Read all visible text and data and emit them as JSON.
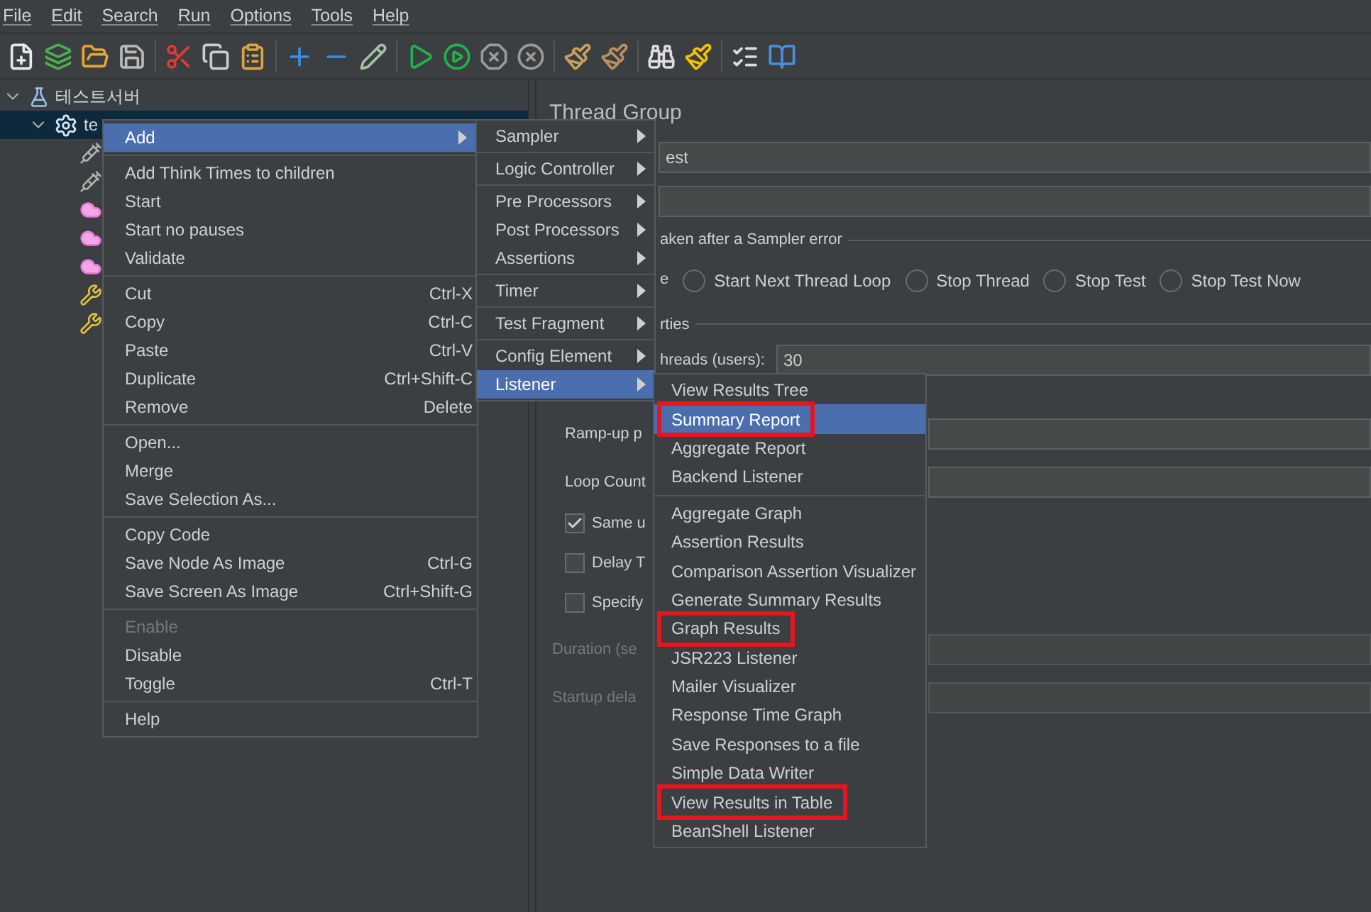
{
  "menu_bar": [
    "File",
    "Edit",
    "Search",
    "Run",
    "Options",
    "Tools",
    "Help"
  ],
  "tree": [
    {
      "label": "테스트서버",
      "kind": "plan",
      "expanded": true,
      "selected": false,
      "children": [
        {
          "label": "te",
          "kind": "group",
          "expanded": true,
          "selected": true,
          "children": [
            {
              "kind": "sampler"
            },
            {
              "kind": "sampler"
            },
            {
              "kind": "listener"
            },
            {
              "kind": "listener"
            },
            {
              "kind": "listener"
            },
            {
              "kind": "config"
            },
            {
              "kind": "config"
            }
          ]
        }
      ]
    }
  ],
  "panel": {
    "title": "Thread Group",
    "name_value": "est",
    "error_group": {
      "legend": "aken after a Sampler error",
      "continue_fragment": "e",
      "options": [
        {
          "label": "Start Next Thread Loop",
          "selected": false
        },
        {
          "label": "Stop Thread",
          "selected": false
        },
        {
          "label": "Stop Test",
          "selected": false
        },
        {
          "label": "Stop Test Now",
          "selected": false
        }
      ]
    },
    "properties": {
      "legend": "rties",
      "threads_label": "hreads (users):",
      "threads_value": "30",
      "rows": [
        {
          "label": "Ramp-up p",
          "disabled": false
        },
        {
          "label": "Loop Count",
          "disabled": false
        }
      ],
      "checks": [
        {
          "label": "Same u",
          "checked": true
        },
        {
          "label": "Delay T",
          "checked": false
        },
        {
          "label": "Specify",
          "checked": false
        }
      ],
      "late_rows": [
        {
          "label": "Duration (se",
          "disabled": true
        },
        {
          "label": "Startup dela",
          "disabled": true
        }
      ]
    }
  },
  "context_menu": [
    {
      "kind": "item",
      "label": "Add",
      "submenu": true,
      "selected": true,
      "disabled": false
    },
    {
      "kind": "separator"
    },
    {
      "kind": "item",
      "label": "Add Think Times to children",
      "selected": false,
      "disabled": false
    },
    {
      "kind": "item",
      "label": "Start",
      "selected": false,
      "disabled": false
    },
    {
      "kind": "item",
      "label": "Start no pauses",
      "selected": false,
      "disabled": false
    },
    {
      "kind": "item",
      "label": "Validate",
      "selected": false,
      "disabled": false
    },
    {
      "kind": "separator"
    },
    {
      "kind": "item",
      "label": "Cut",
      "shortcut": "Ctrl-X",
      "selected": false,
      "disabled": false
    },
    {
      "kind": "item",
      "label": "Copy",
      "shortcut": "Ctrl-C",
      "selected": false,
      "disabled": false
    },
    {
      "kind": "item",
      "label": "Paste",
      "shortcut": "Ctrl-V",
      "selected": false,
      "disabled": false
    },
    {
      "kind": "item",
      "label": "Duplicate",
      "shortcut": "Ctrl+Shift-C",
      "selected": false,
      "disabled": false
    },
    {
      "kind": "item",
      "label": "Remove",
      "shortcut": "Delete",
      "selected": false,
      "disabled": false
    },
    {
      "kind": "separator"
    },
    {
      "kind": "item",
      "label": "Open...",
      "selected": false,
      "disabled": false
    },
    {
      "kind": "item",
      "label": "Merge",
      "selected": false,
      "disabled": false
    },
    {
      "kind": "item",
      "label": "Save Selection As...",
      "selected": false,
      "disabled": false
    },
    {
      "kind": "separator"
    },
    {
      "kind": "item",
      "label": "Copy Code",
      "selected": false,
      "disabled": false
    },
    {
      "kind": "item",
      "label": "Save Node As Image",
      "shortcut": "Ctrl-G",
      "selected": false,
      "disabled": false
    },
    {
      "kind": "item",
      "label": "Save Screen As Image",
      "shortcut": "Ctrl+Shift-G",
      "selected": false,
      "disabled": false
    },
    {
      "kind": "separator"
    },
    {
      "kind": "item",
      "label": "Enable",
      "selected": false,
      "disabled": true
    },
    {
      "kind": "item",
      "label": "Disable",
      "selected": false,
      "disabled": false
    },
    {
      "kind": "item",
      "label": "Toggle",
      "shortcut": "Ctrl-T",
      "selected": false,
      "disabled": false
    },
    {
      "kind": "separator"
    },
    {
      "kind": "item",
      "label": "Help",
      "selected": false,
      "disabled": false
    }
  ],
  "add_submenu": [
    {
      "kind": "item",
      "label": "Sampler",
      "selected": false
    },
    {
      "kind": "separator"
    },
    {
      "kind": "item",
      "label": "Logic Controller",
      "selected": false
    },
    {
      "kind": "separator"
    },
    {
      "kind": "item",
      "label": "Pre Processors",
      "selected": false
    },
    {
      "kind": "item",
      "label": "Post Processors",
      "selected": false
    },
    {
      "kind": "item",
      "label": "Assertions",
      "selected": false
    },
    {
      "kind": "separator"
    },
    {
      "kind": "item",
      "label": "Timer",
      "selected": false
    },
    {
      "kind": "separator"
    },
    {
      "kind": "item",
      "label": "Test Fragment",
      "selected": false
    },
    {
      "kind": "separator"
    },
    {
      "kind": "item",
      "label": "Config Element",
      "selected": false
    },
    {
      "kind": "item",
      "label": "Listener",
      "selected": true
    }
  ],
  "listener_submenu": [
    {
      "kind": "item",
      "label": "View Results Tree",
      "selected": false,
      "marked": false
    },
    {
      "kind": "item",
      "label": "Summary Report",
      "selected": true,
      "marked": true
    },
    {
      "kind": "item",
      "label": "Aggregate Report",
      "selected": false,
      "marked": false
    },
    {
      "kind": "item",
      "label": "Backend Listener",
      "selected": false,
      "marked": false
    },
    {
      "kind": "separator"
    },
    {
      "kind": "item",
      "label": "Aggregate Graph",
      "selected": false,
      "marked": false
    },
    {
      "kind": "item",
      "label": "Assertion Results",
      "selected": false,
      "marked": false
    },
    {
      "kind": "item",
      "label": "Comparison Assertion Visualizer",
      "selected": false,
      "marked": false
    },
    {
      "kind": "item",
      "label": "Generate Summary Results",
      "selected": false,
      "marked": false
    },
    {
      "kind": "item",
      "label": "Graph Results",
      "selected": false,
      "marked": true
    },
    {
      "kind": "item",
      "label": "JSR223 Listener",
      "selected": false,
      "marked": false
    },
    {
      "kind": "item",
      "label": "Mailer Visualizer",
      "selected": false,
      "marked": false
    },
    {
      "kind": "item",
      "label": "Response Time Graph",
      "selected": false,
      "marked": false
    },
    {
      "kind": "item",
      "label": "Save Responses to a file",
      "selected": false,
      "marked": false
    },
    {
      "kind": "item",
      "label": "Simple Data Writer",
      "selected": false,
      "marked": false
    },
    {
      "kind": "item",
      "label": "View Results in Table",
      "selected": false,
      "marked": true
    },
    {
      "kind": "item",
      "label": "BeanShell Listener",
      "selected": false,
      "marked": false
    }
  ]
}
